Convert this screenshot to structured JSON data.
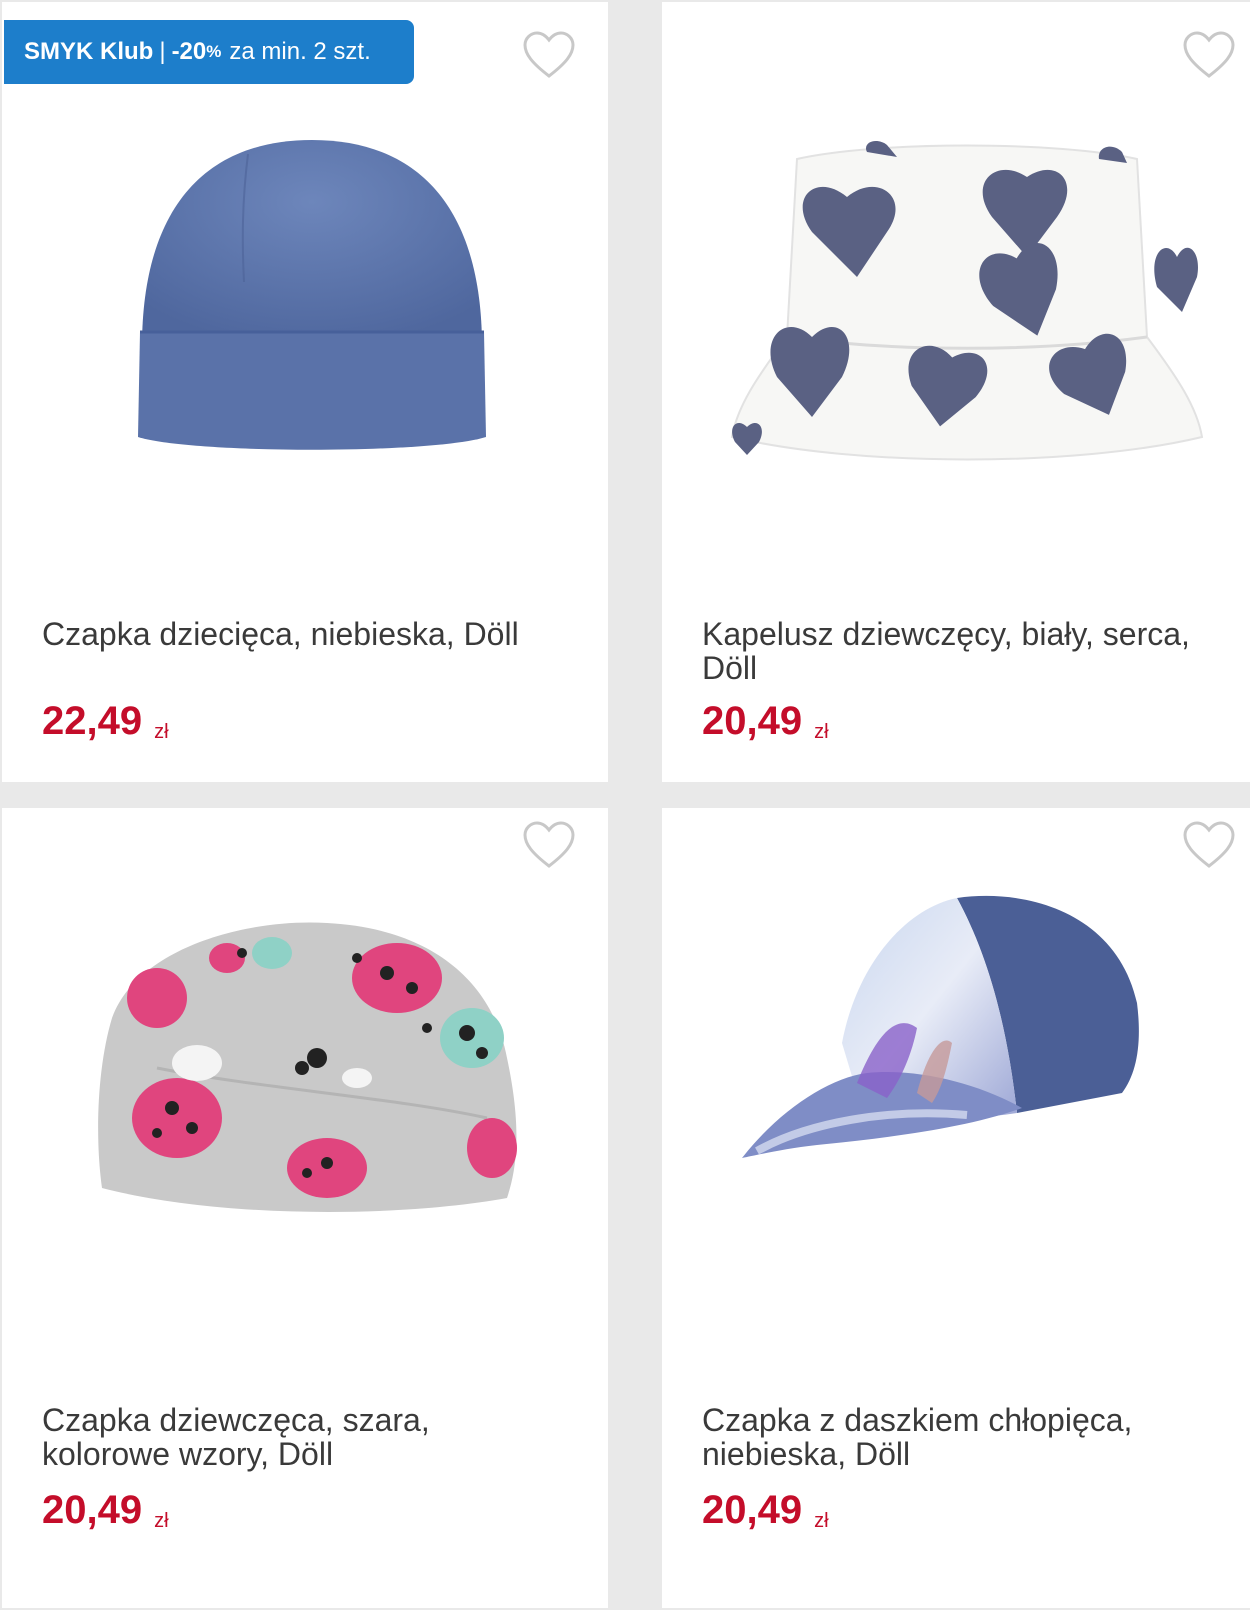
{
  "promo": {
    "brand": "SMYK Klub",
    "separator": "|",
    "discount": "-20",
    "percent": "%",
    "condition": "za min. 2 szt."
  },
  "products": [
    {
      "title": "Czapka dziecięca, niebieska, Döll",
      "price": "22,49",
      "currency": "zł"
    },
    {
      "title": "Kapelusz dziewczęcy, biały, serca, Döll",
      "price": "20,49",
      "currency": "zł"
    },
    {
      "title": "Czapka dziewczęca, szara, kolorowe wzory, Döll",
      "price": "20,49",
      "currency": "zł"
    },
    {
      "title": "Czapka z daszkiem chłopięca, niebieska, Döll",
      "price": "20,49",
      "currency": "zł"
    }
  ],
  "icons": {
    "wishlist": "heart-outline-icon"
  },
  "colors": {
    "price": "#c40d2a",
    "badge": "#1d7ecb",
    "text": "#3a3a3a"
  }
}
